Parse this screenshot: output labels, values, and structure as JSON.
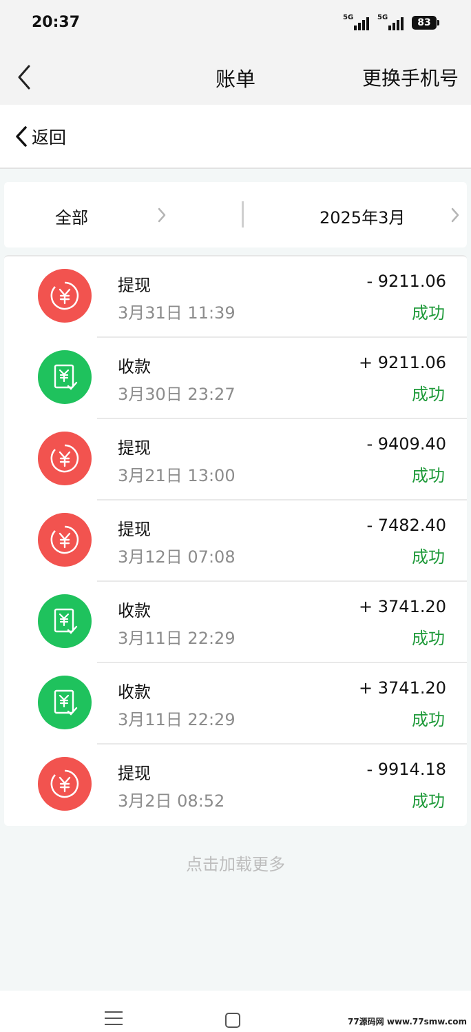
{
  "status_bar": {
    "time": "20:37",
    "signal1_label": "5G",
    "signal2_label": "5G",
    "battery": "83"
  },
  "nav": {
    "title": "账单",
    "right_action": "更换手机号",
    "back_icon": "chevron-left-icon"
  },
  "sub_header": {
    "back_label": "返回"
  },
  "filters": {
    "type_label": "全部",
    "month_label": "2025年3月"
  },
  "colors": {
    "withdraw": "#f2534f",
    "receive": "#1fc25d",
    "success": "#1f9a3a",
    "muted": "#8c8c8c"
  },
  "transactions": [
    {
      "kind": "withdraw",
      "title": "提现",
      "time": "3月31日 11:39",
      "amount": "- 9211.06",
      "status": "成功"
    },
    {
      "kind": "receive",
      "title": "收款",
      "time": "3月30日 23:27",
      "amount": "+ 9211.06",
      "status": "成功"
    },
    {
      "kind": "withdraw",
      "title": "提现",
      "time": "3月21日 13:00",
      "amount": "- 9409.40",
      "status": "成功"
    },
    {
      "kind": "withdraw",
      "title": "提现",
      "time": "3月12日 07:08",
      "amount": "- 7482.40",
      "status": "成功"
    },
    {
      "kind": "receive",
      "title": "收款",
      "time": "3月11日 22:29",
      "amount": "+ 3741.20",
      "status": "成功"
    },
    {
      "kind": "receive",
      "title": "收款",
      "time": "3月11日 22:29",
      "amount": "+ 3741.20",
      "status": "成功"
    },
    {
      "kind": "withdraw",
      "title": "提现",
      "time": "3月2日 08:52",
      "amount": "- 9914.18",
      "status": "成功"
    }
  ],
  "load_more": "点击加载更多",
  "watermark": "77源码网 www.77smw.com"
}
